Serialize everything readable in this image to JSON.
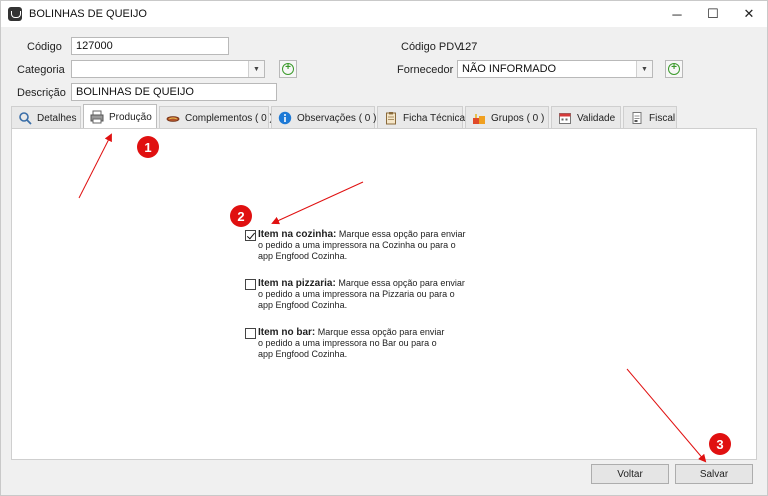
{
  "window": {
    "title": "BOLINHAS DE QUEIJO",
    "minimize": "─",
    "maximize": "☐",
    "close": "✕"
  },
  "form": {
    "codigo_label": "Código",
    "codigo_value": "127000",
    "categoria_label": "Categoria",
    "categoria_value": "",
    "descricao_label": "Descrição",
    "descricao_value": "BOLINHAS DE QUEIJO",
    "codigo_pdv_label": "Código PDV",
    "codigo_pdv_value": "127",
    "fornecedor_label": "Fornecedor",
    "fornecedor_value": "NÃO INFORMADO",
    "combo_arrow": "▼",
    "plus": "+"
  },
  "tabs": [
    {
      "label": "Detalhes",
      "icon": "magnifier-icon"
    },
    {
      "label": "Produção",
      "icon": "printer-icon"
    },
    {
      "label": "Complementos ( 0 )",
      "icon": "sausage-icon"
    },
    {
      "label": "Observações ( 0 )",
      "icon": "info-icon"
    },
    {
      "label": "Ficha Técnica",
      "icon": "clipboard-icon"
    },
    {
      "label": "Grupos ( 0 )",
      "icon": "food-icon"
    },
    {
      "label": "Validade",
      "icon": "calendar-icon"
    },
    {
      "label": "Fiscal",
      "icon": "document-icon"
    }
  ],
  "options": [
    {
      "title": "Item na cozinha:",
      "desc_first": "Marque essa opção para enviar",
      "desc_rest": [
        "o pedido a uma impressora na Cozinha ou para o",
        "app Engfood Cozinha."
      ],
      "checked": true
    },
    {
      "title": "Item na pizzaria:",
      "desc_first": "Marque essa opção para enviar",
      "desc_rest": [
        "o pedido a uma impressora na Pizzaria ou para o",
        "app Engfood Cozinha."
      ],
      "checked": false
    },
    {
      "title": "Item no bar:",
      "desc_first": "Marque essa opção para enviar",
      "desc_rest": [
        "o pedido a uma impressora no Bar ou para o",
        "app Engfood Cozinha."
      ],
      "checked": false
    }
  ],
  "footer": {
    "voltar": "Voltar",
    "salvar": "Salvar"
  },
  "annotations": {
    "badge1": "1",
    "badge2": "2",
    "badge3": "3",
    "color": "#e01010"
  }
}
